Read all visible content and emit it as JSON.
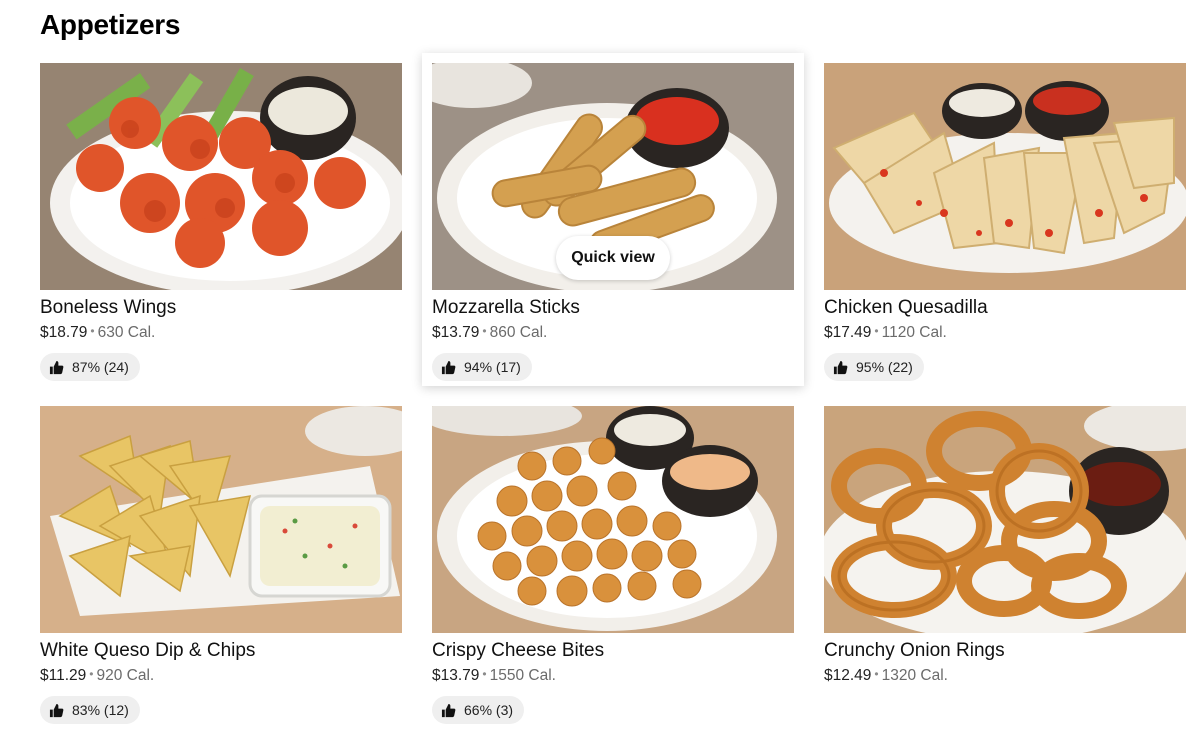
{
  "section": {
    "title": "Appetizers"
  },
  "quick_view_label": "Quick view",
  "items": [
    {
      "name": "Boneless Wings",
      "price": "$18.79",
      "calories": "630 Cal.",
      "rating": "87% (24)",
      "icon": "thumbs-up-icon"
    },
    {
      "name": "Mozzarella Sticks",
      "price": "$13.79",
      "calories": "860 Cal.",
      "rating": "94% (17)",
      "icon": "thumbs-up-icon"
    },
    {
      "name": "Chicken Quesadilla",
      "price": "$17.49",
      "calories": "1120 Cal.",
      "rating": "95% (22)",
      "icon": "thumbs-up-icon"
    },
    {
      "name": "White Queso Dip & Chips",
      "price": "$11.29",
      "calories": "920 Cal.",
      "rating": "83% (12)",
      "icon": "thumbs-up-icon"
    },
    {
      "name": "Crispy Cheese Bites",
      "price": "$13.79",
      "calories": "1550 Cal.",
      "rating": "66% (3)",
      "icon": "thumbs-up-icon"
    },
    {
      "name": "Crunchy Onion Rings",
      "price": "$12.49",
      "calories": "1320 Cal.",
      "rating": "",
      "icon": "thumbs-up-icon"
    }
  ],
  "colors": {
    "rating_pill_bg": "#efefef",
    "text_primary": "#111111",
    "text_secondary": "#6b6b6b"
  }
}
